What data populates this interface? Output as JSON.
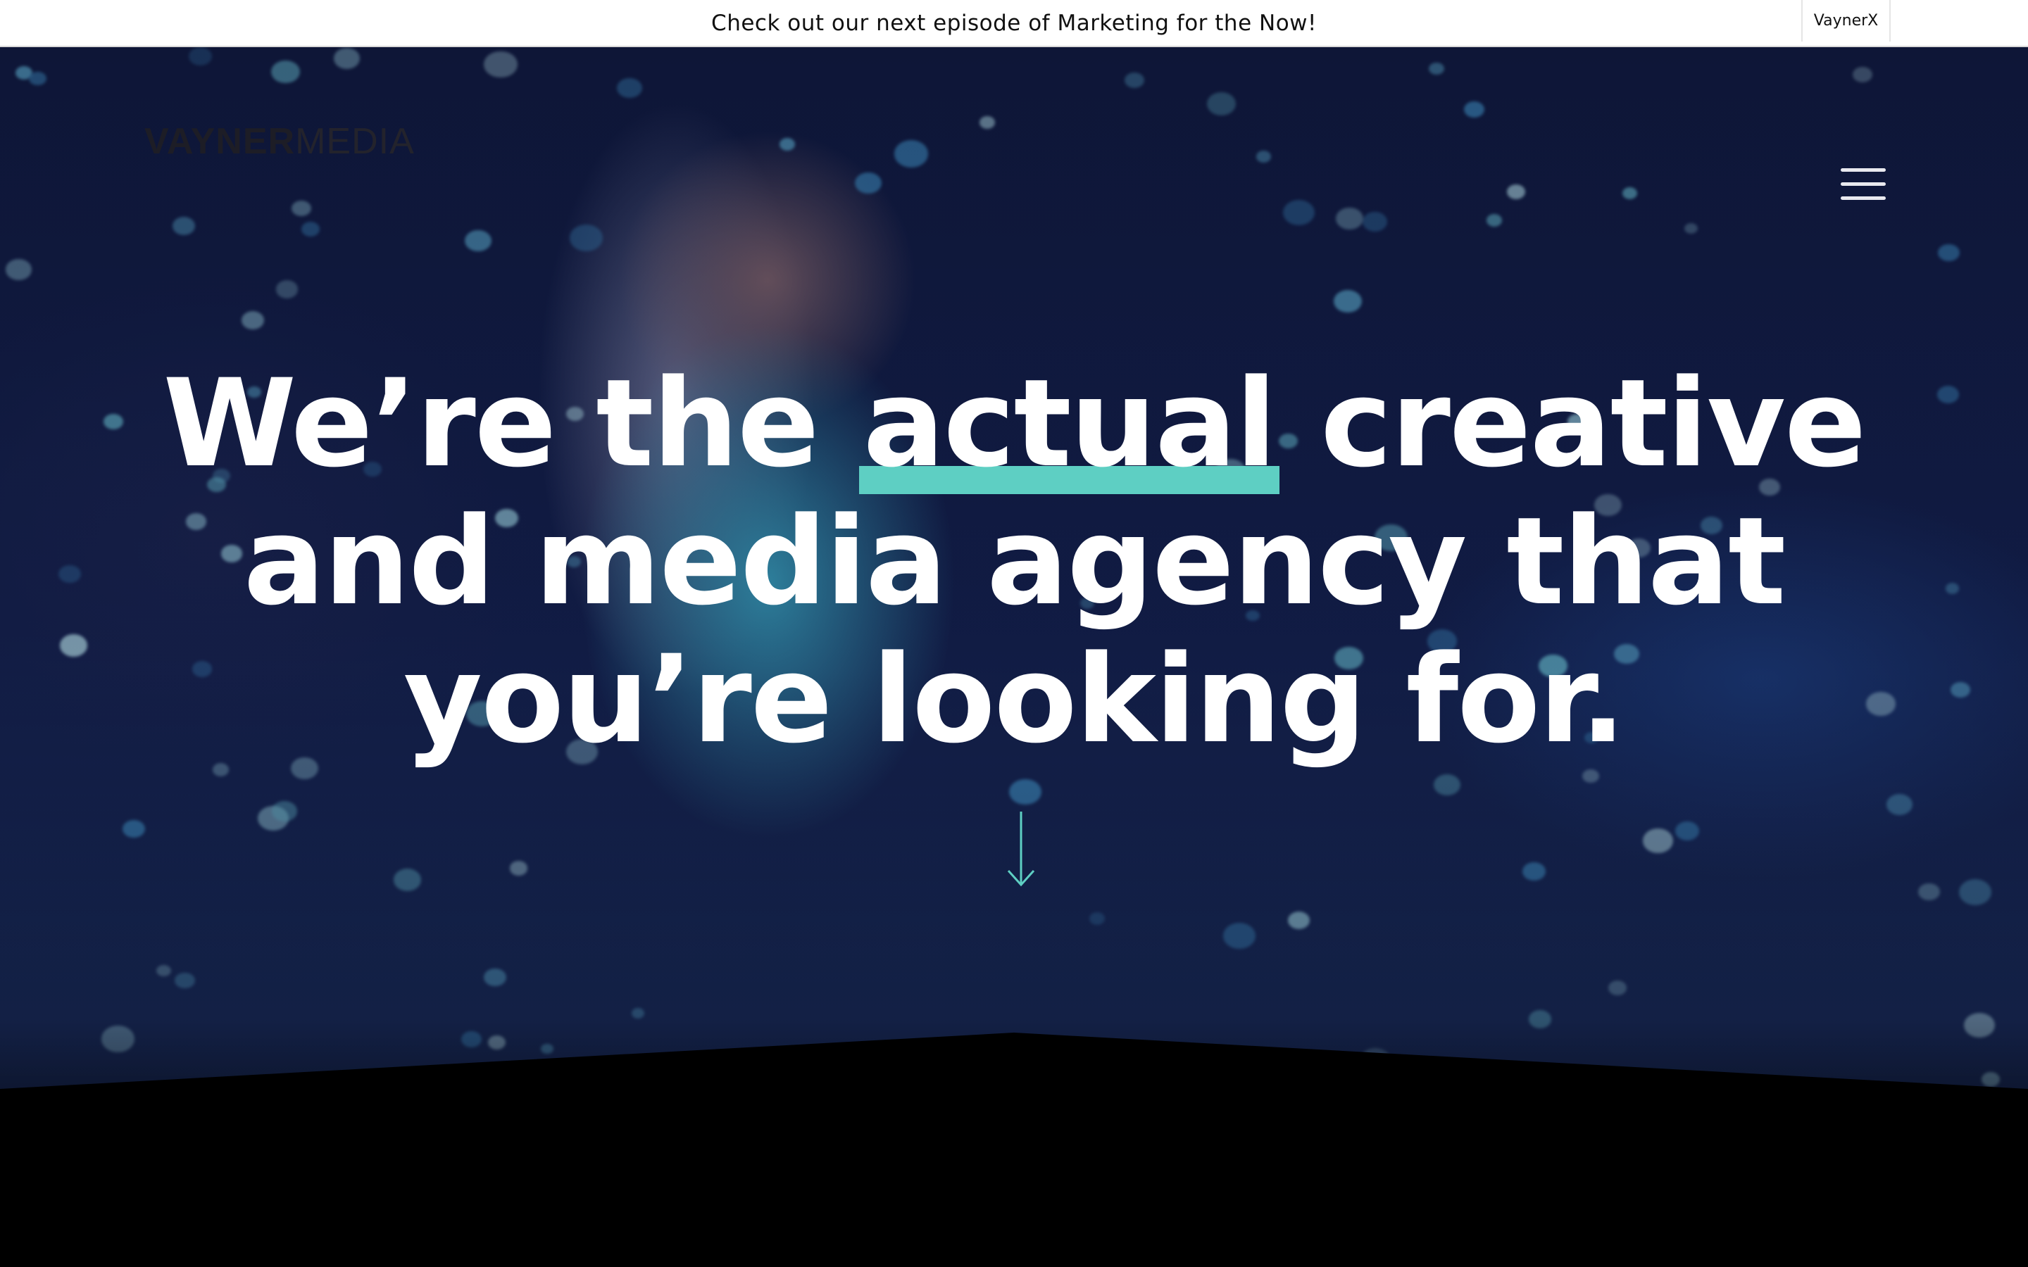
{
  "announcement": {
    "text": "Check out our next episode of Marketing for the Now!",
    "side_link": "VaynerX"
  },
  "header": {
    "logo_bold": "VAYNER",
    "logo_light": "MEDIA",
    "menu_icon": "hamburger-menu-icon"
  },
  "hero": {
    "headline_line1_pre": "We’re the ",
    "headline_line1_highlight": "actual",
    "headline_line1_post": " creative",
    "headline_line2": "and media agency that",
    "headline_line3": "you’re looking for.",
    "scroll_icon": "arrow-down-icon",
    "highlight_color": "#5ecfc3",
    "text_color": "#ffffff"
  },
  "colors": {
    "accent": "#5ecfc3",
    "background": "#000000",
    "banner": "#ffffff"
  }
}
